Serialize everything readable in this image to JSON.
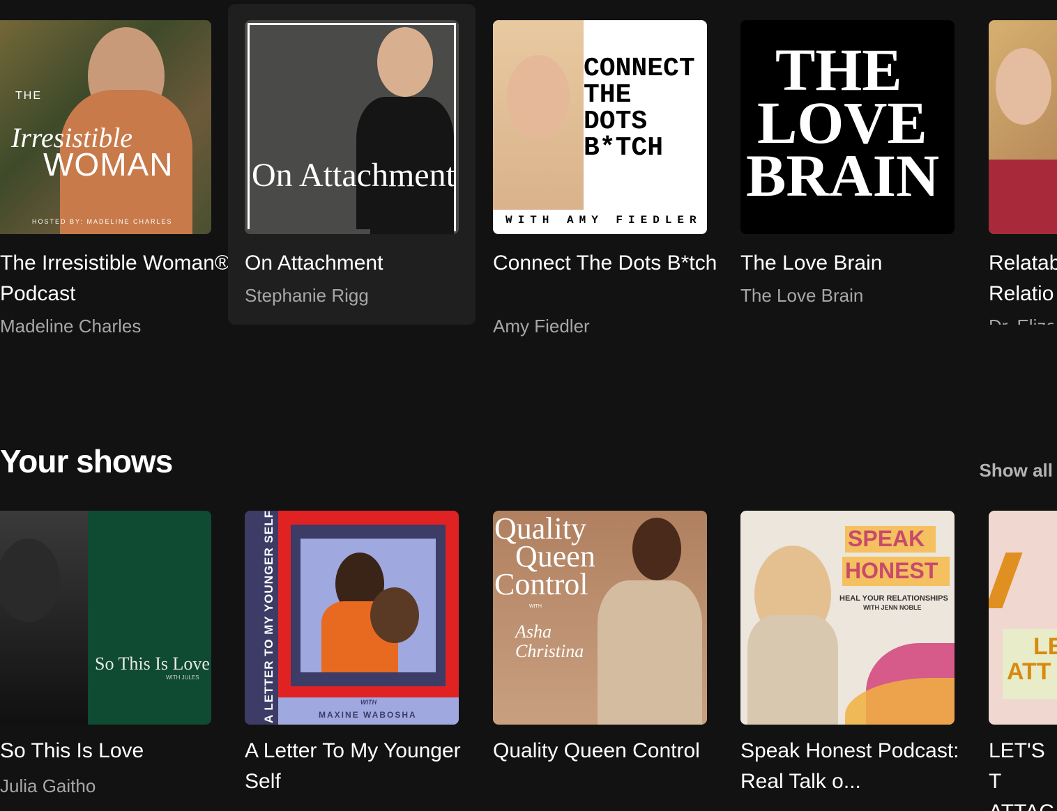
{
  "top_row": {
    "items": [
      {
        "title": "The Irresistible Woman® Podcast",
        "subtitle": "Madeline Charles",
        "art_text": {
          "top": "THE",
          "script": "Irresistible",
          "main": "WOMAN",
          "bottom": "HOSTED BY: MADELINE CHARLES"
        }
      },
      {
        "title": "On Attachment",
        "subtitle": "Stephanie Rigg",
        "art_text": {
          "main": "On Attachment"
        }
      },
      {
        "title": "Connect The Dots B*tch",
        "subtitle": "Amy Fiedler",
        "art_text": {
          "line1": "CONNECT",
          "line2": "THE",
          "line3": "DOTS",
          "line4": "B*TCH",
          "bottom": "WITH AMY FIEDLER"
        }
      },
      {
        "title": "The Love Brain",
        "subtitle": "The Love Brain",
        "art_text": {
          "line1": "THE",
          "line2": "LOVE",
          "line3": "BRAIN"
        }
      },
      {
        "title": "Relatab Relatio",
        "subtitle": "Dr. Eliza"
      }
    ]
  },
  "your_shows": {
    "heading": "Your shows",
    "show_all": "Show all",
    "items": [
      {
        "title": "So This Is Love",
        "subtitle": "Julia Gaitho",
        "art_text": {
          "main": "So This Is Love",
          "small": "WITH JULES"
        }
      },
      {
        "title": "A Letter To My Younger Self",
        "subtitle": "",
        "art_text": {
          "side": "A LETTER TO MY YOUNGER SELF",
          "with": "WITH",
          "name": "MAXINE WABOSHA"
        }
      },
      {
        "title": "Quality Queen Control",
        "subtitle": "",
        "art_text": {
          "line1": "Quality",
          "line2": "Queen",
          "line3": "Control",
          "with": "WITH",
          "sig": "Asha Christina"
        }
      },
      {
        "title": "Speak Honest Podcast: Real Talk o...",
        "subtitle": "",
        "art_text": {
          "line1": "SPEAK",
          "line2": "HONEST",
          "line3": "HEAL YOUR RELATIONSHIPS",
          "line4": "WITH JENN NOBLE"
        }
      },
      {
        "title": "LET'S T ATTAC",
        "subtitle": "",
        "art_text": {
          "line1": "LE",
          "line2": "ATT"
        }
      }
    ]
  },
  "colors": {
    "background": "#121212",
    "hover_card": "#1f1f1f",
    "subtitle": "#a7a7a7"
  }
}
